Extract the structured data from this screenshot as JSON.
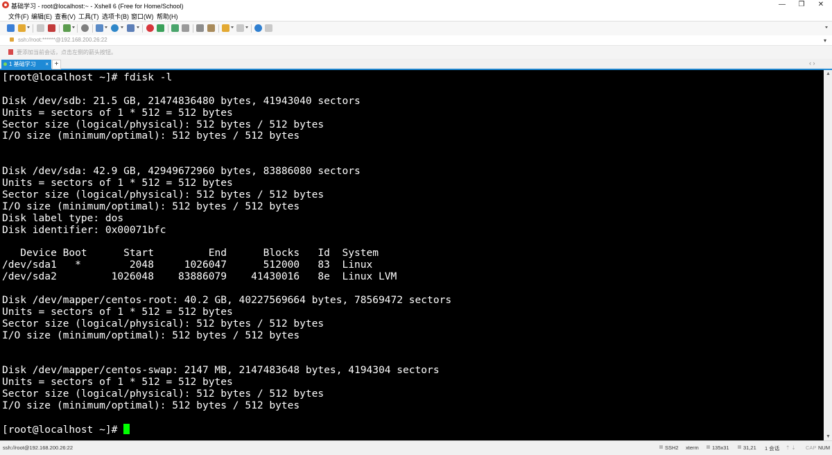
{
  "window": {
    "title": "基础学习 - root@localhost:~ - Xshell 6 (Free for Home/School)",
    "controls": [
      "—",
      "❐",
      "✕"
    ]
  },
  "menu": [
    "文件(F)",
    "编辑(E)",
    "查看(V)",
    "工具(T)",
    "选项卡(B)",
    "窗口(W)",
    "帮助(H)"
  ],
  "address": {
    "value": "ssh://root:******@192.168.200.26:22",
    "dropdown": "▾"
  },
  "hint": {
    "text": "要添加当前会话，点击左侧的箭头按钮。"
  },
  "tabs": [
    {
      "label": "1 基础学习",
      "close": "×"
    }
  ],
  "tab_add": "+",
  "tab_nav": "‹ ›",
  "terminal": {
    "lines": [
      "[root@localhost ~]# fdisk -l",
      "",
      "Disk /dev/sdb: 21.5 GB, 21474836480 bytes, 41943040 sectors",
      "Units = sectors of 1 * 512 = 512 bytes",
      "Sector size (logical/physical): 512 bytes / 512 bytes",
      "I/O size (minimum/optimal): 512 bytes / 512 bytes",
      "",
      "",
      "Disk /dev/sda: 42.9 GB, 42949672960 bytes, 83886080 sectors",
      "Units = sectors of 1 * 512 = 512 bytes",
      "Sector size (logical/physical): 512 bytes / 512 bytes",
      "I/O size (minimum/optimal): 512 bytes / 512 bytes",
      "Disk label type: dos",
      "Disk identifier: 0x00071bfc",
      "",
      "   Device Boot      Start         End      Blocks   Id  System",
      "/dev/sda1   *        2048     1026047      512000   83  Linux",
      "/dev/sda2         1026048    83886079    41430016   8e  Linux LVM",
      "",
      "Disk /dev/mapper/centos-root: 40.2 GB, 40227569664 bytes, 78569472 sectors",
      "Units = sectors of 1 * 512 = 512 bytes",
      "Sector size (logical/physical): 512 bytes / 512 bytes",
      "I/O size (minimum/optimal): 512 bytes / 512 bytes",
      "",
      "",
      "Disk /dev/mapper/centos-swap: 2147 MB, 2147483648 bytes, 4194304 sectors",
      "Units = sectors of 1 * 512 = 512 bytes",
      "Sector size (logical/physical): 512 bytes / 512 bytes",
      "I/O size (minimum/optimal): 512 bytes / 512 bytes",
      ""
    ],
    "prompt": "[root@localhost ~]# ",
    "text_color": "#ffffff",
    "background": "#000000",
    "cursor_color": "#00ff00"
  },
  "status": {
    "path": "ssh://root@192.168.200.26:22",
    "protocol": "SSH2",
    "term": "xterm",
    "size": "135x31",
    "pos": "31,21",
    "sessions": "1 会话",
    "cap": "CAP",
    "num": "NUM"
  },
  "colors": {
    "accent": "#1e8ad6",
    "terminal_bg": "#000000",
    "cursor": "#00ff00"
  }
}
